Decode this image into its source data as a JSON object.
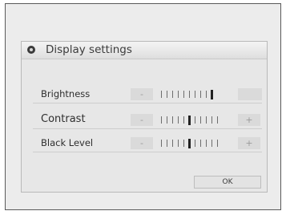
{
  "dialog": {
    "title": "Display settings",
    "icon": "settings-icon"
  },
  "settings": [
    {
      "label": "Brightness",
      "minus": "-",
      "plus": "",
      "level_fraction": 1.0,
      "tick_count": 10
    },
    {
      "label": "Contrast",
      "minus": "-",
      "plus": "+",
      "level_fraction": 0.5,
      "tick_count": 11
    },
    {
      "label": "Black Level",
      "minus": "-",
      "plus": "+",
      "level_fraction": 0.5,
      "tick_count": 11
    }
  ],
  "ok_label": "OK"
}
